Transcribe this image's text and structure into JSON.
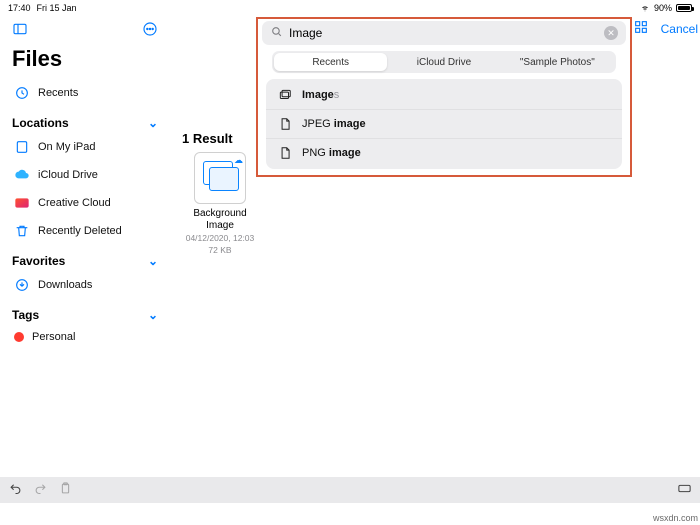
{
  "status": {
    "time": "17:40",
    "date": "Fri 15 Jan",
    "battery_pct": "90%"
  },
  "sidebar": {
    "title": "Files",
    "recents_label": "Recents",
    "sections": {
      "locations": {
        "header": "Locations",
        "items": [
          {
            "label": "On My iPad",
            "icon": "ipad-icon"
          },
          {
            "label": "iCloud Drive",
            "icon": "cloud-icon"
          },
          {
            "label": "Creative Cloud",
            "icon": "creative-cloud-icon"
          },
          {
            "label": "Recently Deleted",
            "icon": "trash-icon"
          }
        ]
      },
      "favorites": {
        "header": "Favorites",
        "items": [
          {
            "label": "Downloads",
            "icon": "download-icon"
          }
        ]
      },
      "tags": {
        "header": "Tags",
        "items": [
          {
            "label": "Personal",
            "color": "#ff3b30"
          }
        ]
      }
    }
  },
  "search": {
    "query": "Image",
    "placeholder": "Search",
    "cancel_label": "Cancel",
    "scopes": [
      "Recents",
      "iCloud Drive",
      "\"Sample Photos\""
    ],
    "selected_scope": 0,
    "suggestions": [
      {
        "kind": "folder",
        "prefix": "Image",
        "suffix": "s"
      },
      {
        "kind": "file",
        "prefix": "JPEG ",
        "match": "image"
      },
      {
        "kind": "file",
        "prefix": "PNG ",
        "match": "image"
      }
    ]
  },
  "results": {
    "header": "1 Result",
    "items": [
      {
        "name": "Background Image",
        "date": "04/12/2020, 12:03",
        "size": "72 KB",
        "cloud": true
      }
    ]
  },
  "watermark": "wsxdn.com"
}
